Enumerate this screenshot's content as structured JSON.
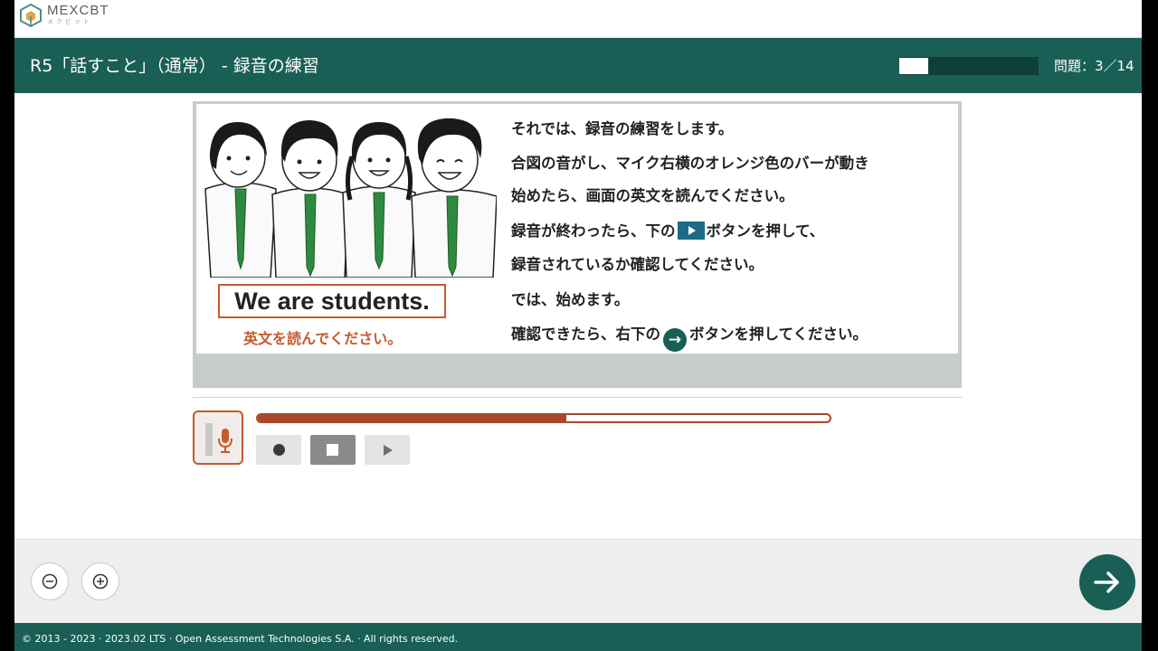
{
  "brand": {
    "name": "MEXCBT",
    "sub": "メクビット"
  },
  "header": {
    "title": "R5「話すこと」（通常） - 録音の練習",
    "progress_fraction": 0.21,
    "counter": "問題：3／14"
  },
  "illustration": {
    "english_sentence": "We are students.",
    "caption": "英文を読んでください。"
  },
  "instructions": [
    "それでは、録音の練習をします。",
    "合図の音がし、マイク右横のオレンジ色のバーが動き",
    "始めたら、画面の英文を読んでください。",
    "録音が終わったら、下の",
    "ボタンを押して、",
    "録音されているか確認してください。",
    "では、始めます。",
    "確認できたら、右下の",
    "ボタンを押してください。"
  ],
  "recorder": {
    "level_fraction": 0.54
  },
  "footer": {
    "copyright": "© 2013 - 2023 · 2023.02 LTS · Open Assessment Technologies S.A. · All rights reserved."
  },
  "colors": {
    "brand": "#1a5f55",
    "accent": "#c55a2b",
    "recording_bar": "#a8472a"
  },
  "icons": {
    "record": "record-icon",
    "stop": "stop-icon",
    "play": "play-icon",
    "zoom_out": "zoom-out-icon",
    "zoom_in": "zoom-in-icon",
    "next": "arrow-right-icon",
    "mic": "microphone-icon"
  }
}
